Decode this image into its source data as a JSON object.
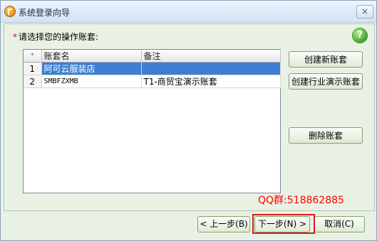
{
  "window": {
    "title": "系统登录向导",
    "close_label": "×"
  },
  "prompt": {
    "required_mark": "*",
    "text": "请选择您的操作账套:"
  },
  "help_icon_glyph": "?",
  "grid": {
    "headers": {
      "row_number": "*",
      "name": "账套名",
      "note": "备注"
    },
    "rows": [
      {
        "index": "1",
        "name": "阿可云服装店",
        "note": ""
      },
      {
        "index": "2",
        "name": "SMBFZXMB",
        "note": "T1-商贸宝演示账套"
      }
    ]
  },
  "actions": {
    "create_new": "创建新账套",
    "create_demo": "创建行业演示账套",
    "delete": "删除账套"
  },
  "watermark": "QQ群:518862885",
  "footer": {
    "prev": "< 上一步(B)",
    "next": "下一步(N) >",
    "cancel": "取消(C)"
  },
  "colors": {
    "selected_row": "#3c7fd2",
    "highlight_border": "#e01818",
    "watermark": "#ff0000"
  }
}
